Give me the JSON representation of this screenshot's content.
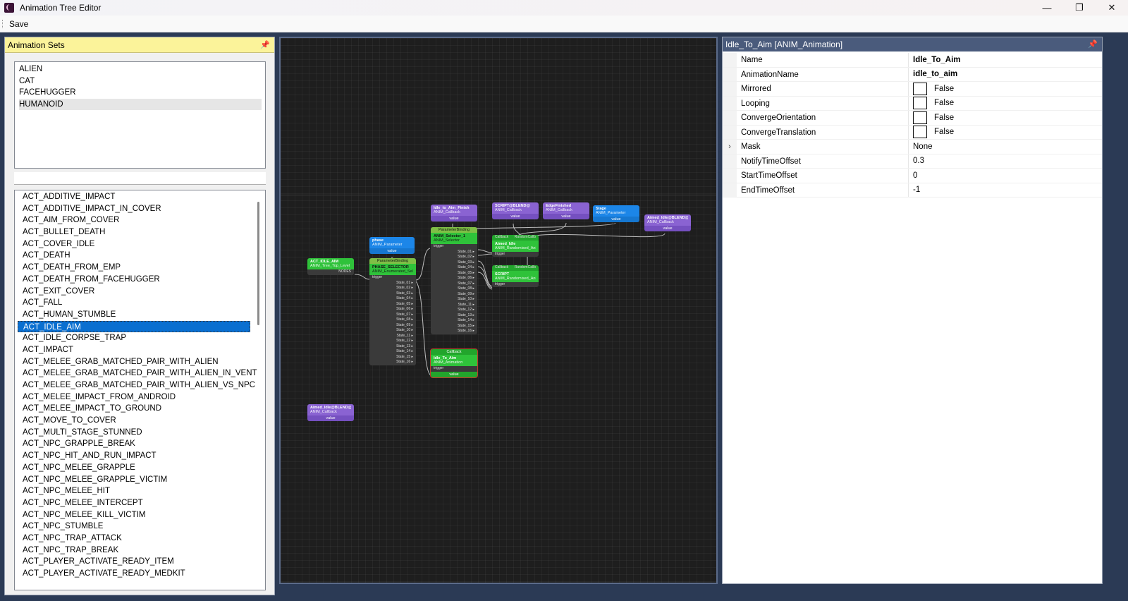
{
  "window": {
    "title": "Animation Tree Editor",
    "controls": {
      "minimize": "—",
      "maximize": "❐",
      "close": "✕"
    }
  },
  "menu": {
    "save": "Save"
  },
  "left_panel": {
    "header": "Animation Sets",
    "pin_icon": "📌",
    "sets": [
      "ALIEN",
      "CAT",
      "FACEHUGGER",
      "HUMANOID"
    ],
    "selected_set": "HUMANOID",
    "search_value": "",
    "animations": [
      "ACT_ADDITIVE_IMPACT",
      "ACT_ADDITIVE_IMPACT_IN_COVER",
      "ACT_AIM_FROM_COVER",
      "ACT_BULLET_DEATH",
      "ACT_COVER_IDLE",
      "ACT_DEATH",
      "ACT_DEATH_FROM_EMP",
      "ACT_DEATH_FROM_FACEHUGGER",
      "ACT_EXIT_COVER",
      "ACT_FALL",
      "ACT_HUMAN_STUMBLE",
      "ACT_IDLE_AIM",
      "ACT_IDLE_CORPSE_TRAP",
      "ACT_IMPACT",
      "ACT_MELEE_GRAB_MATCHED_PAIR_WITH_ALIEN",
      "ACT_MELEE_GRAB_MATCHED_PAIR_WITH_ALIEN_IN_VENT",
      "ACT_MELEE_GRAB_MATCHED_PAIR_WITH_ALIEN_VS_NPC",
      "ACT_MELEE_IMPACT_FROM_ANDROID",
      "ACT_MELEE_IMPACT_TO_GROUND",
      "ACT_MOVE_TO_COVER",
      "ACT_MULTI_STAGE_STUNNED",
      "ACT_NPC_GRAPPLE_BREAK",
      "ACT_NPC_HIT_AND_RUN_IMPACT",
      "ACT_NPC_MELEE_GRAPPLE",
      "ACT_NPC_MELEE_GRAPPLE_VICTIM",
      "ACT_NPC_MELEE_HIT",
      "ACT_NPC_MELEE_INTERCEPT",
      "ACT_NPC_MELEE_KILL_VICTIM",
      "ACT_NPC_STUMBLE",
      "ACT_NPC_TRAP_ATTACK",
      "ACT_NPC_TRAP_BREAK",
      "ACT_PLAYER_ACTIVATE_READY_ITEM",
      "ACT_PLAYER_ACTIVATE_READY_MEDKIT"
    ],
    "selected_animation": "ACT_IDLE_AIM"
  },
  "graph": {
    "nodes": {
      "root": {
        "title": "ACT_IDLE_AIM",
        "sub": "ANIM_Tree_Top_Level",
        "out": "NODES"
      },
      "phase_param": {
        "title": "phase",
        "sub": "ANIM_Parameter",
        "foot": "value"
      },
      "phase_selector": {
        "head": "ParameterBinding",
        "title": "PHASE_SELECTOR",
        "sub": "ANIM_Enumerated_Selec",
        "in": "trigger"
      },
      "idle_finish": {
        "title": "Idle_to_Aim_Finish",
        "sub": "ANIM_Callback",
        "foot": "value"
      },
      "anim_selector": {
        "head": "ParameterBinding",
        "title": "ANIM_Selector_1",
        "sub": "ANIM_Selector",
        "in": "trigger"
      },
      "cb1": {
        "title": "SCRIPT@BLEND@",
        "sub": "ANIM_Callback",
        "foot": "value"
      },
      "edge": {
        "title": "EdgeFinished",
        "sub": "ANIM_Callback",
        "foot": "value"
      },
      "stage": {
        "title": "Stage",
        "sub": "ANIM_Parameter",
        "foot": "value"
      },
      "cb2": {
        "title": "Aimed_Idle@BLEND@",
        "sub": "ANIM_Callback",
        "foot": "value"
      },
      "rand1": {
        "head_l": "Callback",
        "head_r": "RandomCallb",
        "title": "Aimed_Idle",
        "sub": "ANIM_Randomised_Anim",
        "in": "trigger"
      },
      "rand2": {
        "head_l": "Callback",
        "head_r": "RandomCallb",
        "title": "SCRIPT",
        "sub": "ANIM_Randomised_Anim",
        "in": "trigger"
      },
      "idle_to_aim": {
        "head": "Callback",
        "title": "Idle_To_Aim",
        "sub": "ANIM_Animation",
        "in": "trigger",
        "foot": "value"
      },
      "cb3": {
        "title": "Aimed_Idle@BLEND@",
        "sub": "ANIM_Callback",
        "foot": "value"
      }
    },
    "states16": [
      "State_01",
      "State_02",
      "State_03",
      "State_04",
      "State_05",
      "State_06",
      "State_07",
      "State_08",
      "State_09",
      "State_10",
      "State_11",
      "State_12",
      "State_13",
      "State_14",
      "State_15",
      "State_16"
    ]
  },
  "right_panel": {
    "header": "Idle_To_Aim [ANIM_Animation]",
    "pin_icon": "📌",
    "properties": [
      {
        "name": "Name",
        "value": "Idle_To_Aim",
        "type": "bold"
      },
      {
        "name": "AnimationName",
        "value": "idle_to_aim",
        "type": "bold"
      },
      {
        "name": "Mirrored",
        "value": "False",
        "type": "checkbox"
      },
      {
        "name": "Looping",
        "value": "False",
        "type": "checkbox"
      },
      {
        "name": "ConvergeOrientation",
        "value": "False",
        "type": "checkbox"
      },
      {
        "name": "ConvergeTranslation",
        "value": "False",
        "type": "checkbox"
      },
      {
        "name": "Mask",
        "value": "None",
        "type": "expand",
        "expander": "›"
      },
      {
        "name": "NotifyTimeOffset",
        "value": "0.3",
        "type": "text"
      },
      {
        "name": "StartTimeOffset",
        "value": "0",
        "type": "text"
      },
      {
        "name": "EndTimeOffset",
        "value": "-1",
        "type": "text"
      }
    ]
  }
}
